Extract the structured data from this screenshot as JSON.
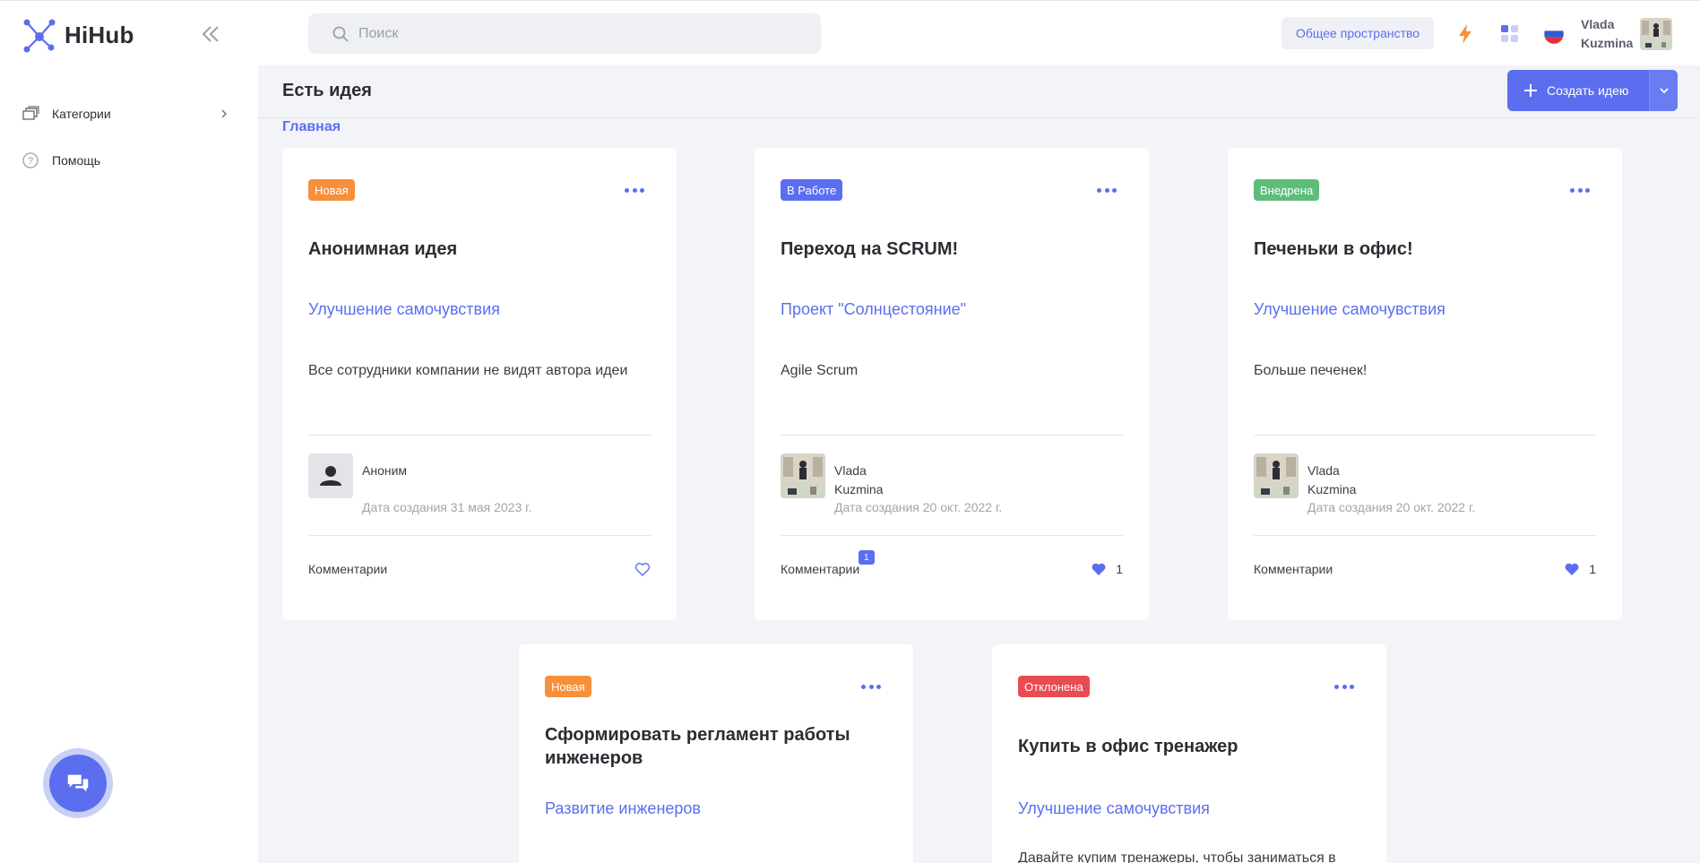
{
  "app": {
    "name": "HiHub"
  },
  "sidebar": {
    "items": [
      {
        "label": "Категории",
        "icon": "categories-icon"
      },
      {
        "label": "Помощь",
        "icon": "help-icon"
      }
    ]
  },
  "header": {
    "search_placeholder": "Поиск",
    "workspace_label": "Общее пространство",
    "user_first": "Vlada",
    "user_last": "Kuzmina"
  },
  "page": {
    "title": "Есть идея",
    "breadcrumb": "Главная",
    "create_label": "Создать идею"
  },
  "colors": {
    "accent": "#5b6ef0",
    "status_new": "#f7903a",
    "status_in_work": "#5b6ef0",
    "status_done": "#5fbd7c",
    "status_rejected": "#e84c52"
  },
  "cards": [
    {
      "status": "Новая",
      "title": "Анонимная идея",
      "category": "Улучшение самочувствия",
      "description": "Все сотрудники компании не видят автора идеи",
      "author": "Аноним",
      "author_last": "",
      "date": "Дата создания 31 мая 2023 г.",
      "comments_label": "Комментарии",
      "comments_count": "",
      "likes": "",
      "liked": false
    },
    {
      "status": "В Работе",
      "title": "Переход на SCRUM!",
      "category": "Проект \"Солнцестояние\"",
      "description": "Agile Scrum",
      "author": "Vlada",
      "author_last": "Kuzmina",
      "date": "Дата создания 20 окт. 2022 г.",
      "comments_label": "Комментарии",
      "comments_count": "1",
      "likes": "1",
      "liked": true
    },
    {
      "status": "Внедрена",
      "title": "Печеньки в офис!",
      "category": "Улучшение самочувствия",
      "description": "Больше печенек!",
      "author": "Vlada",
      "author_last": "Kuzmina",
      "date": "Дата создания 20 окт. 2022 г.",
      "comments_label": "Комментарии",
      "comments_count": "",
      "likes": "1",
      "liked": true
    },
    {
      "status": "Новая",
      "title": "Сформировать регламент работы инженеров",
      "category": "Развитие инженеров"
    },
    {
      "status": "Отклонена",
      "title": "Купить в офис тренажер",
      "category": "Улучшение самочувствия",
      "description": "Давайте купим тренажеры, чтобы заниматься в"
    }
  ]
}
